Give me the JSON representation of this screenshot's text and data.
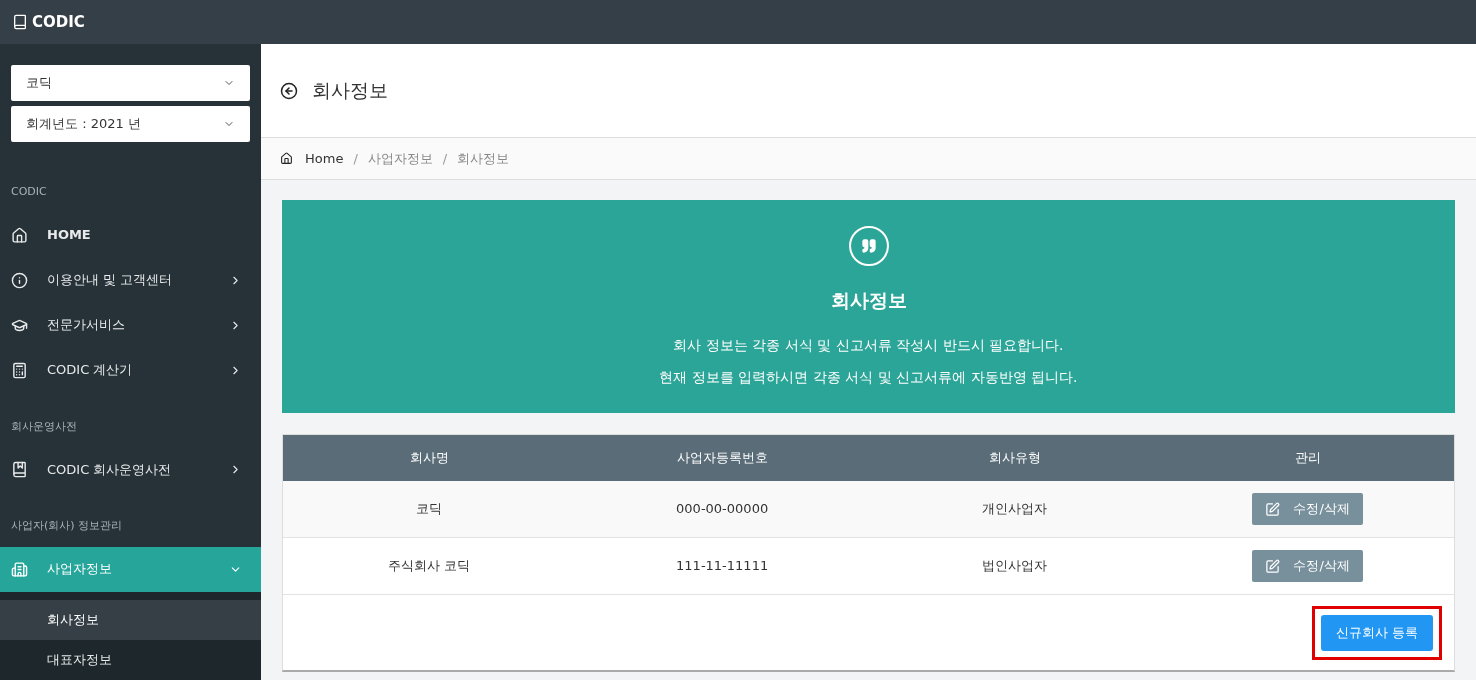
{
  "topbar": {
    "brand": "CODIC"
  },
  "sidebar": {
    "selects": [
      {
        "value": "코딕"
      },
      {
        "value": "회계년도 : 2021 년"
      }
    ],
    "items": [
      {
        "kind": "header",
        "label": "CODIC"
      },
      {
        "kind": "link",
        "label": "HOME",
        "selected": false
      },
      {
        "kind": "menu",
        "label": "이용안내 및 고객센터",
        "selected": false,
        "expanded": false
      },
      {
        "kind": "menu",
        "label": "전문가서비스",
        "selected": false,
        "expanded": false
      },
      {
        "kind": "menu",
        "label": "CODIC 계산기",
        "selected": false,
        "expanded": false
      },
      {
        "kind": "header",
        "label": "회사운영사전"
      },
      {
        "kind": "menu",
        "label": "CODIC 회사운영사전",
        "selected": false,
        "expanded": false
      },
      {
        "kind": "header",
        "label": "사업자(회사) 정보관리"
      },
      {
        "kind": "menu",
        "label": "사업자정보",
        "selected": true,
        "expanded": true,
        "children": [
          {
            "label": "회사정보",
            "selected": true
          },
          {
            "label": "대표자정보",
            "selected": false
          }
        ]
      }
    ]
  },
  "page": {
    "title": "회사정보",
    "breadcrumb": [
      "Home",
      "/",
      "사업자정보",
      "/",
      "회사정보"
    ]
  },
  "banner": {
    "title": "회사정보",
    "lines": [
      "회사 정보는 각종 서식 및 신고서류 작성시 반드시 필요합니다.",
      "현재 정보를 입력하시면 각종 서식 및 신고서류에 자동반영 됩니다."
    ]
  },
  "table": {
    "columns": [
      "회사명",
      "사업자등록번호",
      "회사유형",
      "관리"
    ],
    "rows": [
      {
        "cells": [
          "코딕",
          "000-00-00000",
          "개인사업자"
        ],
        "action": "수정/삭제"
      },
      {
        "cells": [
          "주식회사 코딕",
          "111-11-11111",
          "법인사업자"
        ],
        "action": "수정/삭제"
      }
    ],
    "add_button": {
      "label": "신규회사 등록",
      "highlighted": true
    }
  }
}
